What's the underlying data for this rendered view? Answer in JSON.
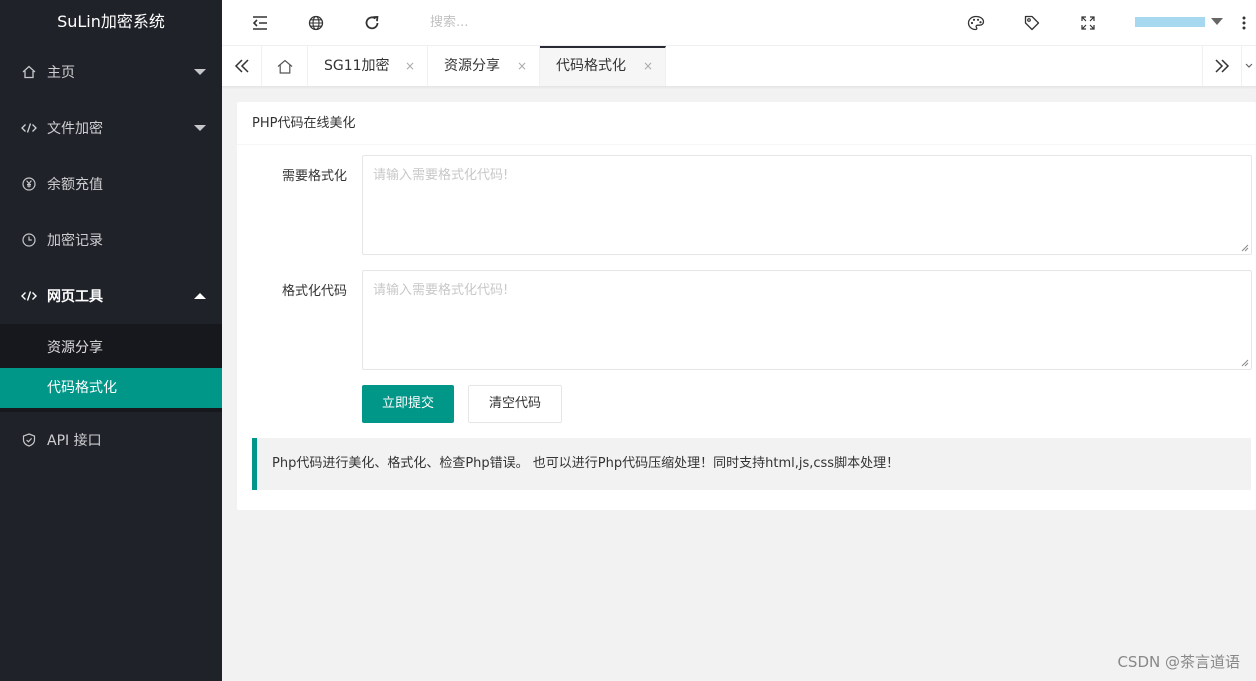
{
  "app": {
    "title": "SuLin加密系统"
  },
  "sidebar": {
    "items": [
      {
        "label": "主页",
        "icon": "home-icon"
      },
      {
        "label": "文件加密",
        "icon": "code-icon"
      },
      {
        "label": "余额充值",
        "icon": "yen-icon"
      },
      {
        "label": "加密记录",
        "icon": "clock-icon"
      },
      {
        "label": "网页工具",
        "icon": "code-icon"
      },
      {
        "label": "API 接口",
        "icon": "shield-icon"
      }
    ],
    "subitems": [
      {
        "label": "资源分享"
      },
      {
        "label": "代码格式化"
      }
    ]
  },
  "header": {
    "search_placeholder": "搜索..."
  },
  "tabs": [
    {
      "label": "SG11加密",
      "close": "×"
    },
    {
      "label": "资源分享",
      "close": "×"
    },
    {
      "label": "代码格式化",
      "close": "×"
    }
  ],
  "main": {
    "title": "PHP代码在线美化",
    "field1": {
      "label": "需要格式化",
      "placeholder": "请输入需要格式化代码!"
    },
    "field2": {
      "label": "格式化代码",
      "placeholder": "请输入需要格式化代码!"
    },
    "submit_label": "立即提交",
    "clear_label": "清空代码",
    "note": "Php代码进行美化、格式化、检查Php错误。 也可以进行Php代码压缩处理！同时支持html,js,css脚本处理！"
  },
  "watermark": "CSDN @茶言道语",
  "colors": {
    "sidebar_bg": "#20222a",
    "accent": "#009688",
    "page_bg": "#f2f2f2"
  }
}
